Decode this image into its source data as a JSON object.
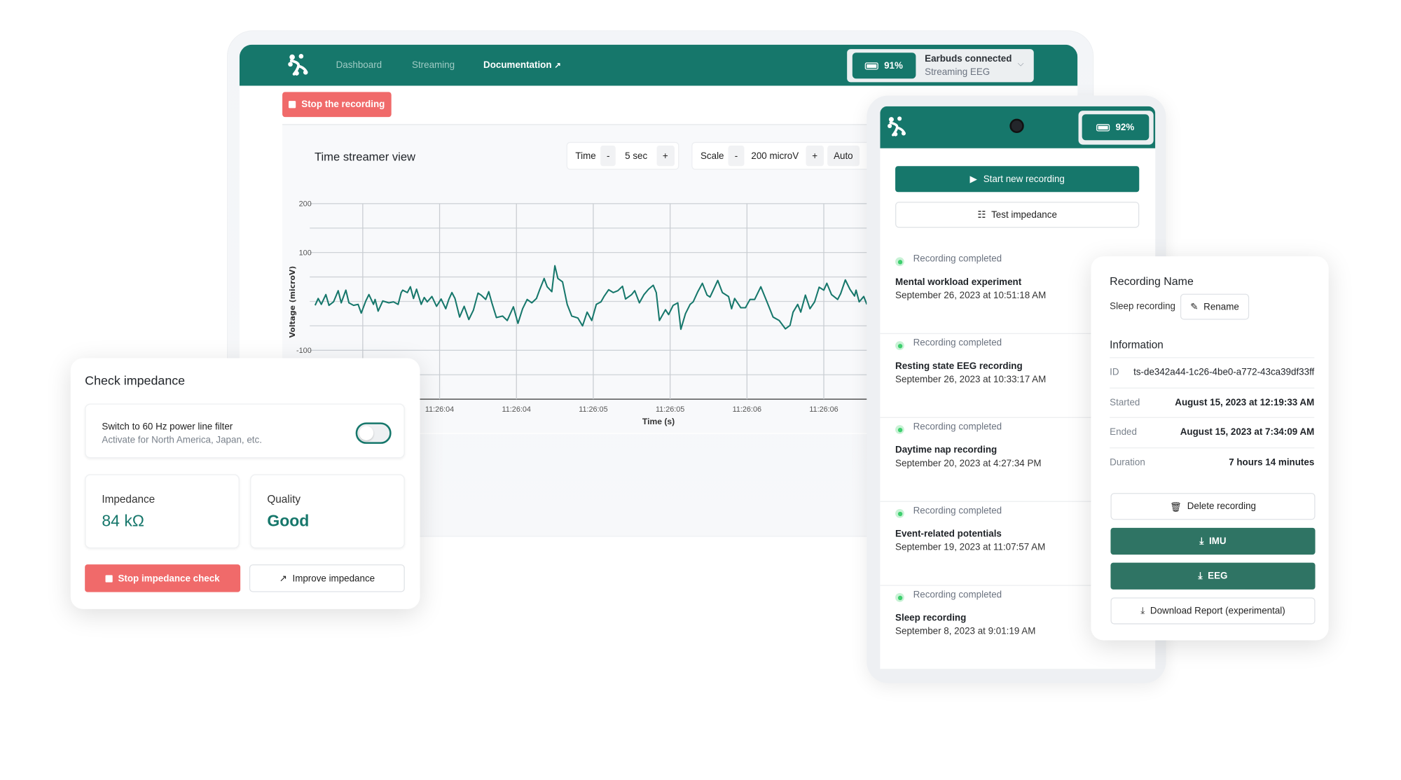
{
  "colors": {
    "brand": "#16776b",
    "danger": "#f06a6a",
    "success": "#3ecf6e",
    "download_button": "#2f7464"
  },
  "desktop": {
    "nav": [
      {
        "label": "Dashboard"
      },
      {
        "label": "Streaming"
      },
      {
        "label": "Documentation",
        "icon": "external-link-icon"
      }
    ],
    "status": {
      "battery": "91%",
      "title": "Earbuds connected",
      "subtitle": "Streaming EEG"
    },
    "stop_recording": "Stop the recording",
    "chart_title": "Time streamer view",
    "time_control": {
      "label": "Time",
      "minus": "-",
      "value": "5 sec",
      "plus": "+"
    },
    "scale_control": {
      "label": "Scale",
      "minus": "-",
      "value": "200 microV",
      "plus": "+",
      "auto": "Auto"
    }
  },
  "chart_data": {
    "type": "line",
    "title": "Time streamer view",
    "xlabel": "Time (s)",
    "ylabel": "Voltage (microV)",
    "ylim": [
      -200,
      200
    ],
    "y_ticks": [
      {
        "value": 200,
        "label": "200"
      },
      {
        "value": 100,
        "label": "100"
      },
      {
        "value": -100,
        "label": "-100"
      }
    ],
    "y_grid_step": 50,
    "x_ticks": [
      {
        "value": 3.5,
        "label": ""
      },
      {
        "value": 4.0,
        "label": "11:26:04"
      },
      {
        "value": 4.5,
        "label": "11:26:04"
      },
      {
        "value": 5.0,
        "label": "11:26:05"
      },
      {
        "value": 5.5,
        "label": "11:26:05"
      },
      {
        "value": 6.0,
        "label": "11:26:06"
      },
      {
        "value": 6.5,
        "label": "11:26:06"
      }
    ],
    "grid": true,
    "line_color": "#16776b",
    "series": [
      {
        "x": [
          3.19,
          3.21,
          3.23,
          3.26,
          3.28,
          3.31,
          3.34,
          3.36,
          3.39,
          3.41,
          3.44,
          3.47,
          3.49,
          3.52,
          3.54,
          3.57,
          3.58,
          3.6,
          3.63,
          3.67,
          3.7,
          3.73,
          3.75,
          3.76,
          3.79,
          3.81,
          3.83,
          3.85,
          3.88,
          3.9,
          3.92,
          3.95,
          3.98,
          4.01,
          4.04,
          4.06,
          4.08,
          4.1,
          4.13,
          4.16,
          4.19,
          4.22,
          4.25,
          4.27,
          4.3,
          4.32,
          4.34,
          4.37,
          4.41,
          4.44,
          4.48,
          4.51,
          4.54,
          4.57,
          4.6,
          4.63,
          4.65,
          4.68,
          4.7,
          4.73,
          4.75,
          4.77,
          4.8,
          4.83,
          4.86,
          4.9,
          4.93,
          4.96,
          4.99,
          5.02,
          5.05,
          5.07,
          5.1,
          5.13,
          5.16,
          5.19,
          5.21,
          5.25,
          5.27,
          5.3,
          5.33,
          5.36,
          5.39,
          5.41,
          5.43,
          5.47,
          5.49,
          5.52,
          5.55,
          5.57,
          5.6,
          5.63,
          5.65,
          5.68,
          5.71,
          5.74,
          5.76,
          5.81,
          5.84,
          5.88,
          5.9,
          5.92,
          5.96,
          5.99,
          6.02,
          6.05,
          6.09,
          6.13,
          6.17,
          6.21,
          6.25,
          6.28,
          6.3,
          6.33,
          6.35,
          6.38,
          6.41,
          6.44,
          6.47,
          6.5,
          6.52,
          6.55,
          6.59,
          6.61,
          6.64,
          6.67,
          6.7,
          6.71,
          6.73,
          6.76,
          6.78
        ],
        "values": [
          -8,
          6,
          -6,
          14,
          -8,
          -1,
          22,
          -3,
          23,
          -3,
          -8,
          -6,
          -24,
          1,
          14,
          -6,
          4,
          -20,
          1,
          -3,
          -1,
          -6,
          18,
          23,
          18,
          30,
          6,
          25,
          -6,
          8,
          -1,
          10,
          -10,
          5,
          -15,
          4,
          18,
          6,
          -32,
          -10,
          -37,
          -18,
          17,
          13,
          4,
          20,
          -3,
          -33,
          -30,
          -39,
          -11,
          -45,
          -15,
          4,
          -3,
          6,
          23,
          47,
          30,
          20,
          73,
          47,
          40,
          -6,
          -30,
          -34,
          -50,
          -22,
          -39,
          -6,
          -1,
          10,
          24,
          18,
          22,
          31,
          5,
          14,
          22,
          -3,
          14,
          25,
          33,
          18,
          -39,
          -17,
          -27,
          -8,
          -3,
          -57,
          -25,
          -6,
          -1,
          20,
          37,
          13,
          9,
          43,
          18,
          10,
          -15,
          6,
          -13,
          -13,
          4,
          4,
          30,
          -1,
          -32,
          -39,
          -56,
          -49,
          -22,
          -6,
          -22,
          13,
          -15,
          -1,
          29,
          23,
          37,
          14,
          4,
          16,
          44,
          25,
          11,
          23,
          -1,
          10,
          -6
        ]
      }
    ]
  },
  "impedance": {
    "title": "Check impedance",
    "filter_label": "Switch to 60 Hz power line filter",
    "filter_hint": "Activate for North America, Japan, etc.",
    "filter_on": false,
    "impedance_label": "Impedance",
    "impedance_value": "84 kΩ",
    "quality_label": "Quality",
    "quality_value": "Good",
    "stop_button": "Stop impedance check",
    "improve_button": "Improve impedance"
  },
  "phone": {
    "battery": "92%",
    "start_button": "Start new recording",
    "test_button": "Test impedance",
    "recordings": [
      {
        "status": "Recording completed",
        "name": "Mental workload experiment",
        "date": "September 26, 2023 at 10:51:18 AM"
      },
      {
        "status": "Recording completed",
        "name": "Resting state EEG recording",
        "date": "September 26, 2023 at 10:33:17 AM"
      },
      {
        "status": "Recording completed",
        "name": "Daytime nap recording",
        "date": "September 20, 2023 at 4:27:34 PM"
      },
      {
        "status": "Recording completed",
        "name": "Event-related potentials",
        "date": "September 19, 2023 at 11:07:57 AM"
      },
      {
        "status": "Recording completed",
        "name": "Sleep recording",
        "date": "September 8, 2023 at 9:01:19 AM"
      }
    ]
  },
  "details": {
    "name_heading": "Recording Name",
    "name": "Sleep recording",
    "rename": "Rename",
    "info_heading": "Information",
    "rows": [
      {
        "label": "ID",
        "value": "ts-de342a44-1c26-4be0-a772-43ca39df33ff"
      },
      {
        "label": "Started",
        "value": "August 15, 2023 at 12:19:33 AM"
      },
      {
        "label": "Ended",
        "value": "August 15, 2023 at 7:34:09 AM"
      },
      {
        "label": "Duration",
        "value": "7 hours 14 minutes"
      }
    ],
    "delete": "Delete recording",
    "imu": "IMU",
    "eeg": "EEG",
    "report": "Download Report (experimental)"
  }
}
